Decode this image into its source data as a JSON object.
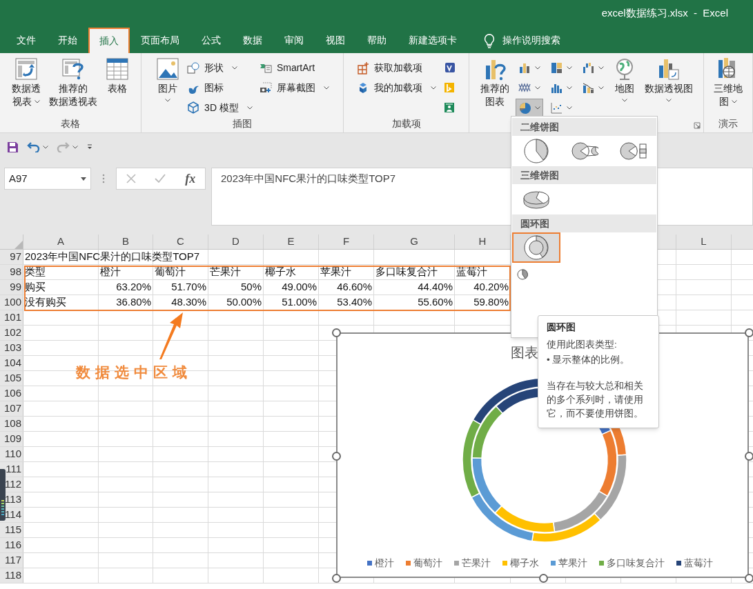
{
  "window": {
    "title": "excel数据练习.xlsx  -  Excel"
  },
  "tabs": [
    {
      "label": "文件",
      "selected": false
    },
    {
      "label": "开始",
      "selected": false
    },
    {
      "label": "插入",
      "selected": true
    },
    {
      "label": "页面布局",
      "selected": false
    },
    {
      "label": "公式",
      "selected": false
    },
    {
      "label": "数据",
      "selected": false
    },
    {
      "label": "审阅",
      "selected": false
    },
    {
      "label": "视图",
      "selected": false
    },
    {
      "label": "帮助",
      "selected": false
    },
    {
      "label": "新建选项卡",
      "selected": false
    }
  ],
  "tell_me": "操作说明搜索",
  "ribbon": [
    {
      "label": "表格",
      "items": [
        {
          "kind": "large",
          "lines": [
            "数据透",
            "视表"
          ],
          "dropdown": true
        },
        {
          "kind": "large",
          "lines": [
            "推荐的",
            "数据透视表"
          ]
        },
        {
          "kind": "large",
          "lines": [
            "表格"
          ]
        }
      ]
    },
    {
      "label": "插图",
      "items": [
        {
          "kind": "large",
          "lines": [
            "图片"
          ],
          "dropdown": true
        },
        {
          "kind": "stack",
          "items": [
            {
              "label": "形状",
              "dropdown": true
            },
            {
              "label": "图标",
              "dropdown": false
            },
            {
              "label": "3D 模型",
              "dropdown": true
            }
          ]
        },
        {
          "kind": "stack",
          "items": [
            {
              "label": "SmartArt",
              "dropdown": false
            },
            {
              "label": "屏幕截图",
              "dropdown": true
            }
          ]
        }
      ]
    },
    {
      "label": "加载项",
      "items": [
        {
          "kind": "stack",
          "items": [
            {
              "label": "获取加载项",
              "dropdown": false
            },
            {
              "label": "我的加载项",
              "dropdown": true
            }
          ]
        },
        {
          "kind": "stack",
          "items": [
            {
              "dropdown": false
            },
            {
              "dropdown": false
            },
            {
              "dropdown": false
            }
          ]
        }
      ]
    },
    {
      "items": [
        {
          "kind": "large",
          "lines": [
            "推荐的",
            "图表"
          ]
        },
        {
          "kind": "grid",
          "items": [
            {
              "dropdown": true,
              "selected": false
            },
            {
              "dropdown": true,
              "selected": false
            },
            {
              "dropdown": true,
              "selected": false
            },
            {
              "dropdown": true,
              "selected": false
            },
            {
              "dropdown": true,
              "selected": false
            },
            {
              "dropdown": true,
              "selected": false
            },
            {
              "dropdown": true,
              "selected": true
            },
            {
              "dropdown": true,
              "selected": false
            }
          ]
        },
        {
          "kind": "large",
          "lines": [
            "地图"
          ],
          "dropdown": true
        },
        {
          "kind": "large",
          "lines": [
            "数据透视图"
          ],
          "dropdown": true
        }
      ]
    },
    {
      "label": "演示",
      "items": [
        {
          "kind": "large",
          "lines": [
            "三维地",
            "图"
          ],
          "dropdown": true
        }
      ]
    }
  ],
  "quick_access": [
    {
      "kind": "save"
    },
    {
      "kind": "undo",
      "dropdown": true,
      "disabled": false
    },
    {
      "kind": "redo",
      "dropdown": true,
      "disabled": true
    },
    {
      "kind": "customize"
    }
  ],
  "formula_bar": {
    "name_box": "A97",
    "fx": "fx",
    "formula": "2023年中国NFC果汁的口味类型TOP7"
  },
  "sheet": {
    "columns": [
      "A",
      "B",
      "C",
      "D",
      "E",
      "F",
      "G",
      "H"
    ],
    "right_columns": [
      "L"
    ],
    "rows": [
      {
        "number": "97",
        "kind": "text",
        "cells": [
          "2023年中国NFC果汁的口味类型TOP7"
        ]
      },
      {
        "number": "98",
        "kind": "text",
        "cells": [
          "类型",
          "橙汁",
          "葡萄汁",
          "芒果汁",
          "椰子水",
          "苹果汁",
          "多口味复合汁",
          "蓝莓汁"
        ]
      },
      {
        "number": "99",
        "kind": "values",
        "cells": [
          "购买",
          "63.20%",
          "51.70%",
          "50%",
          "49.00%",
          "46.60%",
          "44.40%",
          "40.20%"
        ]
      },
      {
        "number": "100",
        "kind": "values",
        "cells": [
          "没有购买",
          "36.80%",
          "48.30%",
          "50.00%",
          "51.00%",
          "53.40%",
          "55.60%",
          "59.80%"
        ]
      },
      {
        "number": "101"
      },
      {
        "number": "102"
      },
      {
        "number": "103"
      },
      {
        "number": "104"
      },
      {
        "number": "105"
      },
      {
        "number": "106"
      },
      {
        "number": "107"
      },
      {
        "number": "108"
      },
      {
        "number": "109"
      },
      {
        "number": "110"
      },
      {
        "number": "111"
      },
      {
        "number": "112"
      },
      {
        "number": "113"
      },
      {
        "number": "114"
      },
      {
        "number": "115"
      },
      {
        "number": "116"
      },
      {
        "number": "117"
      },
      {
        "number": "118"
      }
    ]
  },
  "annotation": {
    "text": "数据选中区域"
  },
  "chart": {
    "title": "图表",
    "legend": [
      {
        "label": "橙汁",
        "color": "#4472c4"
      },
      {
        "label": "葡萄汁",
        "color": "#ed7d31"
      },
      {
        "label": "芒果汁",
        "color": "#a5a5a5"
      },
      {
        "label": "椰子水",
        "color": "#ffc000"
      },
      {
        "label": "苹果汁",
        "color": "#5b9bd5"
      },
      {
        "label": "多口味复合汁",
        "color": "#70ad47"
      },
      {
        "label": "蓝莓汁",
        "color": "#264478"
      }
    ]
  },
  "dropdown": {
    "sections": [
      {
        "title": "二维饼图",
        "options": [
          {
            "selected": false
          },
          {
            "selected": false
          },
          {
            "selected": false
          }
        ]
      },
      {
        "title": "三维饼图",
        "options": [
          {
            "selected": false
          }
        ]
      },
      {
        "title": "圆环图",
        "options": [
          {
            "selected": true
          }
        ]
      }
    ]
  },
  "tooltip": {
    "title": "圆环图",
    "lines": [
      "使用此图表类型:",
      "• 显示整体的比例。"
    ],
    "body": "当存在与较大总和相关的多个系列时，请使用它，而不要使用饼图。"
  }
}
